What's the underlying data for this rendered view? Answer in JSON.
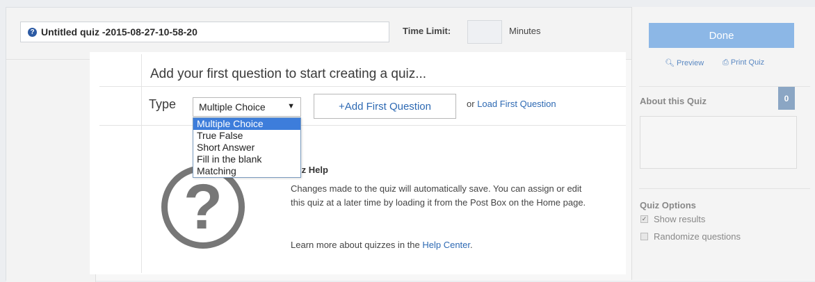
{
  "quiz": {
    "title": "Untitled quiz -2015-08-27-10-58-20",
    "time_limit_label": "Time Limit:",
    "time_limit_value": "",
    "time_limit_units": "Minutes"
  },
  "main": {
    "heading": "Add your first question to start creating a quiz...",
    "type_label": "Type",
    "type_selected": "Multiple Choice",
    "type_options": [
      "Multiple Choice",
      "True False",
      "Short Answer",
      "Fill in the blank",
      "Matching"
    ],
    "add_button": "+Add First Question",
    "or_text": "or",
    "load_link": "Load First Question"
  },
  "help": {
    "title": "Quiz Help",
    "body": "Changes made to the quiz will automatically save. You can assign or edit this quiz at a later time by loading it from the Post Box on the Home page.",
    "more_prefix": "Learn more about quizzes in the",
    "more_link": "Help Center",
    "more_suffix": "."
  },
  "sidebar": {
    "done": "Done",
    "preview": "Preview",
    "print": "Print Quiz",
    "about_title": "About this Quiz",
    "about_count": "0",
    "options_title": "Quiz Options",
    "show_results": "Show results",
    "show_results_checked": true,
    "randomize": "Randomize questions",
    "randomize_checked": false
  },
  "colors": {
    "accent": "#2d69b3",
    "done_button": "#8cb7e6",
    "dropdown_highlight": "#3d7ddb",
    "badge": "#8ba6c4"
  },
  "icons": {
    "title_icon": "question-circle-icon",
    "preview_icon": "magnifier-icon",
    "print_icon": "printer-icon",
    "help_icon": "question-mark-icon"
  }
}
